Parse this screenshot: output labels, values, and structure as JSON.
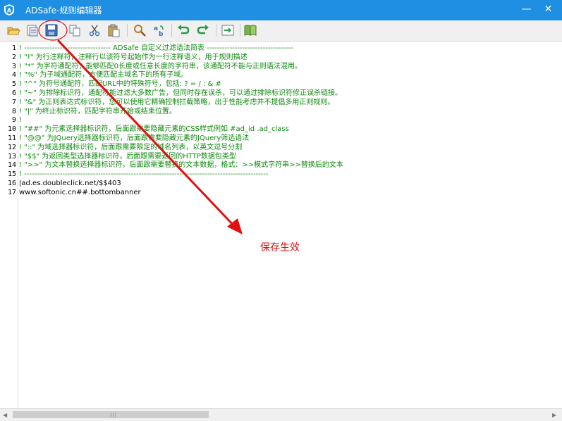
{
  "window": {
    "title": "ADSafe-规则编辑器",
    "minimize": "—",
    "close": "✕"
  },
  "toolbar": {
    "buttons": [
      "open-folder-icon",
      "print-preview-icon",
      "save-icon",
      "copy-icon",
      "cut-icon",
      "paste-icon",
      "find-icon",
      "replace-icon",
      "undo-icon",
      "redo-icon",
      "export-icon",
      "help-book-icon"
    ]
  },
  "editor": {
    "lines": [
      {
        "n": "1",
        "text": "! ---------------------------------- ADSafe 自定义过滤语法简表 ----------------------------------",
        "kind": "comment"
      },
      {
        "n": "2",
        "text": "! \"!\" 为行注释符，注释行以该符号起始作为一行注释语义，用于规则描述",
        "kind": "comment"
      },
      {
        "n": "3",
        "text": "! \"*\" 为字符通配符，能够匹配0长度或任意长度的字符串，该通配符不能与正则语法混用。",
        "kind": "comment"
      },
      {
        "n": "4",
        "text": "! \"%\" 为子域通配符，方便匹配主域名下的所有子域。",
        "kind": "comment"
      },
      {
        "n": "5",
        "text": "! \"^\" 为符号通配符，匹配URL中的特殊符号，包括: ? = / : & #",
        "kind": "comment"
      },
      {
        "n": "6",
        "text": "! \"~\" 为排除标识符，通配符能过滤大多数广告，但同时存在误杀，可以通过排除标识符修正误杀链接。",
        "kind": "comment"
      },
      {
        "n": "7",
        "text": "! \"&\" 为正则表达式标识符，您可以使用它精确控制拦截策略，出于性能考虑并不提倡多用正则规则。",
        "kind": "comment"
      },
      {
        "n": "8",
        "text": "! \"|\" 为终止标识符，匹配字符串开始或结束位置。",
        "kind": "comment"
      },
      {
        "n": "9",
        "text": "!",
        "kind": "comment"
      },
      {
        "n": "10",
        "text": "! \"##\" 为元素选择器标识符，后面跟需要隐藏元素的CSS样式例如 #ad_id  .ad_class",
        "kind": "comment"
      },
      {
        "n": "11",
        "text": "! \"@@\" 为JQuery选择器标识符，后面跟需要隐藏元素的JQuery筛选语法",
        "kind": "comment"
      },
      {
        "n": "12",
        "text": "! \"::\" 为域选择器标识符，后面跟需要限定的域名列表，以英文逗号分割",
        "kind": "comment"
      },
      {
        "n": "13",
        "text": "! \"$$\" 为返回类型选择器标识符，后面跟需要返回的HTTP数据包类型",
        "kind": "comment"
      },
      {
        "n": "14",
        "text": "! \">>\" 为文本替换选择器标识符，后面跟需要替换的文本数据，格式：>>模式字符串>>替换后的文本",
        "kind": "comment"
      },
      {
        "n": "15",
        "text": "! ------------------------------------------------------------------------------------------------",
        "kind": "comment"
      },
      {
        "n": "16",
        "text": "|ad.es.doubleclick.net/$$403",
        "kind": "rule"
      },
      {
        "n": "17",
        "text": "www.softonic.cn##.bottombanner",
        "kind": "rule"
      }
    ]
  },
  "annotation": {
    "text": "保存生效",
    "color": "#e01010"
  },
  "scrollbar": {
    "left_arrow": "◀",
    "right_arrow": "▶",
    "grip": "|||"
  },
  "colors": {
    "titlebar": "#1f8fe3",
    "comment": "#108a10",
    "annotation": "#e01010"
  }
}
